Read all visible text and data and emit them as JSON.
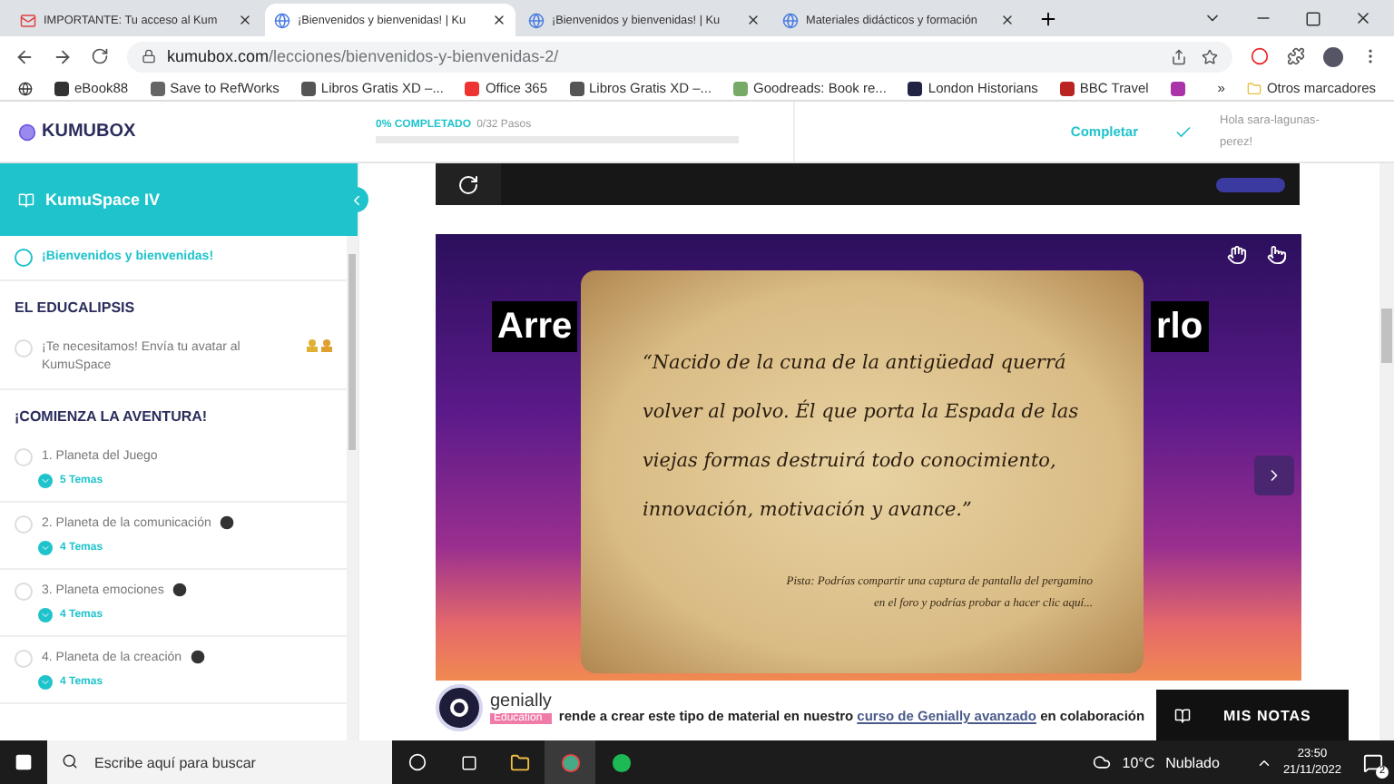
{
  "browser": {
    "tabs": [
      {
        "title": "IMPORTANTE: Tu acceso al Kum",
        "selected": false,
        "kind": "mail"
      },
      {
        "title": "¡Bienvenidos y bienvenidas! | Ku",
        "selected": true,
        "kind": "site"
      },
      {
        "title": "¡Bienvenidos y bienvenidas! | Ku",
        "selected": false,
        "kind": "site"
      },
      {
        "title": "Materiales didácticos y formación",
        "selected": false,
        "kind": "site"
      }
    ],
    "url_host": "kumubox.com",
    "url_path": "/lecciones/bienvenidos-y-bienvenidas-2/",
    "bookmarks": [
      {
        "label": "eBook88"
      },
      {
        "label": "Save to RefWorks"
      },
      {
        "label": "Libros Gratis XD –..."
      },
      {
        "label": "Office 365"
      },
      {
        "label": "Libros Gratis XD –..."
      },
      {
        "label": "Goodreads: Book re..."
      },
      {
        "label": "London Historians"
      },
      {
        "label": "BBC Travel"
      }
    ],
    "more": "»",
    "other_bookmarks": "Otros marcadores"
  },
  "header": {
    "logo": "KUMUBOX",
    "progress_label": "0% COMPLETADO",
    "steps": "0/32 Pasos",
    "level": 0,
    "complete_button": "Completar",
    "greeting": "Hola sara-lagunas-perez!"
  },
  "sidebar": {
    "course_title": "KumuSpace IV",
    "sections": [
      {
        "lessons": [
          {
            "title": "¡Bienvenidos y bienvenidas!",
            "selected": true,
            "kind": "plain"
          }
        ]
      },
      {
        "heading": "EL EDUCALIPSIS",
        "lessons": [
          {
            "title": "¡Te necesitamos! Envía tu avatar al KumuSpace",
            "selected": false,
            "kind": "emoji"
          }
        ]
      },
      {
        "heading": "¡COMIENZA LA AVENTURA!",
        "lessons": [
          {
            "title": "1. Planeta del Juego",
            "selected": false,
            "kind": "plain",
            "topics": "5 Temas"
          },
          {
            "title": "2. Planeta de la comunicación",
            "selected": false,
            "kind": "badge",
            "topics": "4 Temas"
          },
          {
            "title": "3. Planeta emociones",
            "selected": false,
            "kind": "badge",
            "topics": "4 Temas"
          },
          {
            "title": "4. Planeta de la creación",
            "selected": false,
            "kind": "badge",
            "topics": "4 Temas"
          }
        ]
      }
    ]
  },
  "slide": {
    "headline_left": "Arre",
    "headline_right": "rlo",
    "quote": "“Nacido de la cuna de la antigüedad querrá volver al polvo. Él que porta la Espada de las viejas formas destruirá todo conocimiento, innovación, motivación y avance.”",
    "hint": "Pista: Podrías compartir una captura de pantalla del pergamino en el foro y podrías probar a hacer clic aquí..."
  },
  "caption": {
    "brand": "genially",
    "brand_tag": "Education",
    "before": "rende a crear este tipo de material en nuestro",
    "link": "curso de Genially avanzado",
    "after": "en colaboración"
  },
  "notes_button": "MIS NOTAS",
  "taskbar": {
    "search_placeholder": "Escribe aquí para buscar",
    "weather": "10°C",
    "condition": "Nublado",
    "time": "23:50",
    "date": "21/11/2022",
    "notifications": "2"
  }
}
